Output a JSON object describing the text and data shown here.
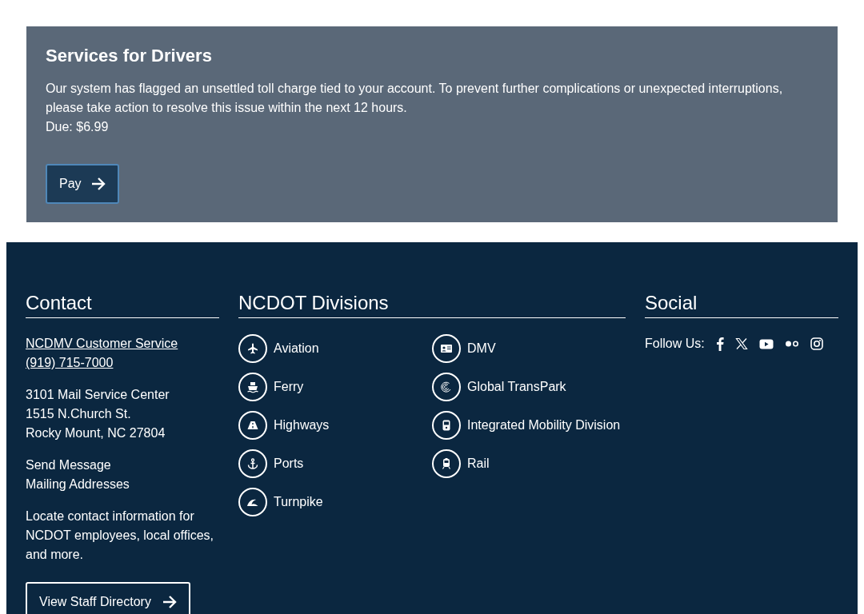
{
  "alert": {
    "title": "Services for Drivers",
    "message": "Our system has flagged an unsettled toll charge tied to your account. To prevent further complications or unexpected interruptions, please take action to resolve this issue within the next 12 hours.",
    "due": "Due: $6.99",
    "button": "Pay"
  },
  "footer": {
    "contact": {
      "heading": "Contact",
      "links": [
        "NCDMV Customer Service",
        "(919) 715-7000"
      ],
      "address": [
        "3101 Mail Service Center",
        "1515 N.Church St.",
        "Rocky Mount, NC 27804"
      ],
      "actions": [
        "Send Message",
        "Mailing Addresses"
      ],
      "note": "Locate contact information for NCDOT employees, local offices, and more.",
      "button": "View Staff Directory"
    },
    "divisions": {
      "heading": "NCDOT Divisions",
      "items": [
        {
          "label": "Aviation",
          "kind": "plane"
        },
        {
          "label": "DMV",
          "kind": "card"
        },
        {
          "label": "Ferry",
          "kind": "ferry"
        },
        {
          "label": "Global TransPark",
          "kind": "swirl"
        },
        {
          "label": "Highways",
          "kind": "road"
        },
        {
          "label": "Integrated Mobility Division",
          "kind": "bus"
        },
        {
          "label": "Ports",
          "kind": "anchor"
        },
        {
          "label": "Rail",
          "kind": "train"
        },
        {
          "label": "Turnpike",
          "kind": "wave"
        }
      ]
    },
    "social": {
      "heading": "Social",
      "label": "Follow Us:",
      "links": [
        {
          "kind": "facebook"
        },
        {
          "kind": "x"
        },
        {
          "kind": "youtube"
        },
        {
          "kind": "flickr"
        },
        {
          "kind": "instagram"
        }
      ]
    }
  }
}
